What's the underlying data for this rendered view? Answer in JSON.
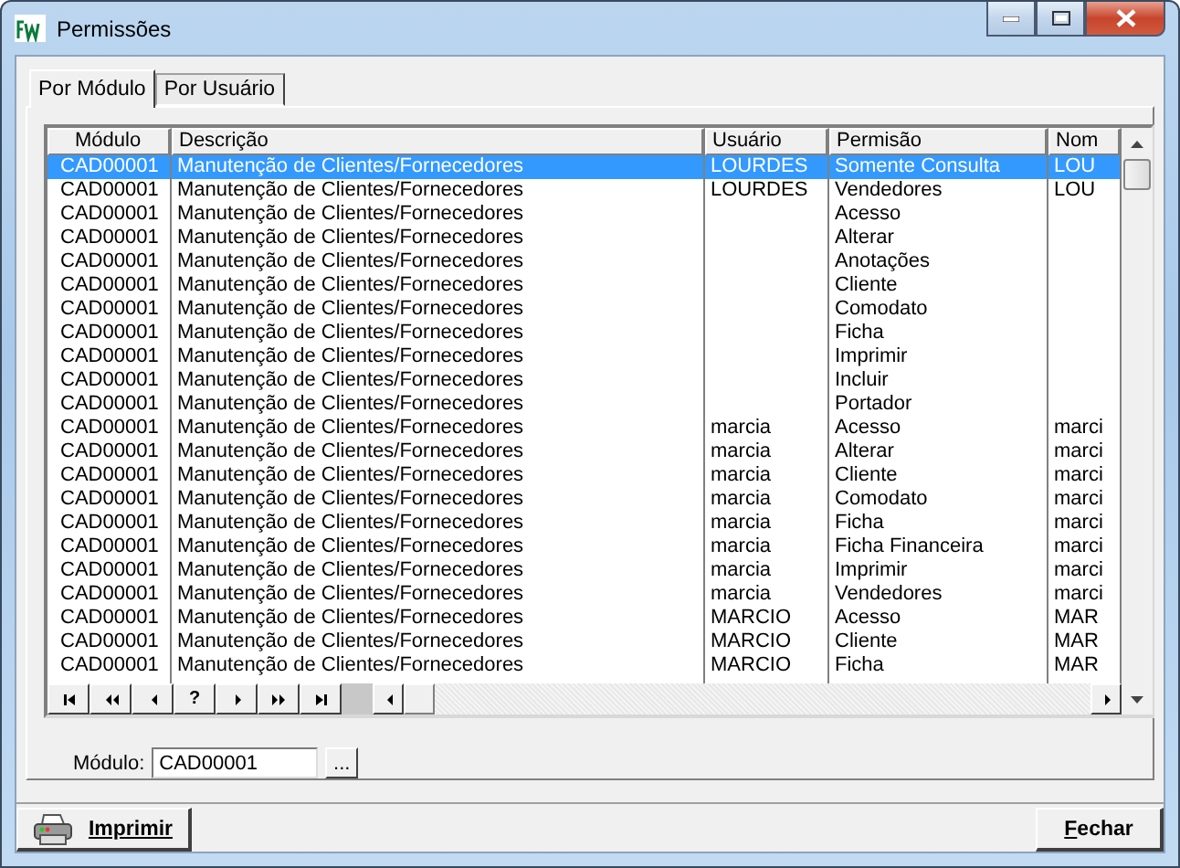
{
  "window": {
    "title": "Permissões"
  },
  "tabs": [
    {
      "label": "Por Módulo",
      "selected": true
    },
    {
      "label": "Por Usuário",
      "selected": false
    }
  ],
  "table": {
    "columns": [
      "Módulo",
      "Descrição",
      "Usuário",
      "Permisão",
      "Nom"
    ],
    "rows": [
      {
        "cells": [
          "CAD00001",
          "Manutenção de Clientes/Fornecedores",
          "LOURDES",
          "Somente Consulta",
          "LOU"
        ],
        "selected": true
      },
      {
        "cells": [
          "CAD00001",
          "Manutenção de Clientes/Fornecedores",
          "LOURDES",
          "Vendedores",
          "LOU"
        ],
        "selected": false
      },
      {
        "cells": [
          "CAD00001",
          "Manutenção de Clientes/Fornecedores",
          "",
          "Acesso",
          ""
        ],
        "selected": false
      },
      {
        "cells": [
          "CAD00001",
          "Manutenção de Clientes/Fornecedores",
          "",
          "Alterar",
          ""
        ],
        "selected": false
      },
      {
        "cells": [
          "CAD00001",
          "Manutenção de Clientes/Fornecedores",
          "",
          "Anotações",
          ""
        ],
        "selected": false
      },
      {
        "cells": [
          "CAD00001",
          "Manutenção de Clientes/Fornecedores",
          "",
          "Cliente",
          ""
        ],
        "selected": false
      },
      {
        "cells": [
          "CAD00001",
          "Manutenção de Clientes/Fornecedores",
          "",
          "Comodato",
          ""
        ],
        "selected": false
      },
      {
        "cells": [
          "CAD00001",
          "Manutenção de Clientes/Fornecedores",
          "",
          "Ficha",
          ""
        ],
        "selected": false
      },
      {
        "cells": [
          "CAD00001",
          "Manutenção de Clientes/Fornecedores",
          "",
          "Imprimir",
          ""
        ],
        "selected": false
      },
      {
        "cells": [
          "CAD00001",
          "Manutenção de Clientes/Fornecedores",
          "",
          "Incluir",
          ""
        ],
        "selected": false
      },
      {
        "cells": [
          "CAD00001",
          "Manutenção de Clientes/Fornecedores",
          "",
          "Portador",
          ""
        ],
        "selected": false
      },
      {
        "cells": [
          "CAD00001",
          "Manutenção de Clientes/Fornecedores",
          "marcia",
          "Acesso",
          "marci"
        ],
        "selected": false
      },
      {
        "cells": [
          "CAD00001",
          "Manutenção de Clientes/Fornecedores",
          "marcia",
          "Alterar",
          "marci"
        ],
        "selected": false
      },
      {
        "cells": [
          "CAD00001",
          "Manutenção de Clientes/Fornecedores",
          "marcia",
          "Cliente",
          "marci"
        ],
        "selected": false
      },
      {
        "cells": [
          "CAD00001",
          "Manutenção de Clientes/Fornecedores",
          "marcia",
          "Comodato",
          "marci"
        ],
        "selected": false
      },
      {
        "cells": [
          "CAD00001",
          "Manutenção de Clientes/Fornecedores",
          "marcia",
          "Ficha",
          "marci"
        ],
        "selected": false
      },
      {
        "cells": [
          "CAD00001",
          "Manutenção de Clientes/Fornecedores",
          "marcia",
          "Ficha Financeira",
          "marci"
        ],
        "selected": false
      },
      {
        "cells": [
          "CAD00001",
          "Manutenção de Clientes/Fornecedores",
          "marcia",
          "Imprimir",
          "marci"
        ],
        "selected": false
      },
      {
        "cells": [
          "CAD00001",
          "Manutenção de Clientes/Fornecedores",
          "marcia",
          "Vendedores",
          "marci"
        ],
        "selected": false
      },
      {
        "cells": [
          "CAD00001",
          "Manutenção de Clientes/Fornecedores",
          "MARCIO",
          "Acesso",
          "MAR"
        ],
        "selected": false
      },
      {
        "cells": [
          "CAD00001",
          "Manutenção de Clientes/Fornecedores",
          "MARCIO",
          "Cliente",
          "MAR"
        ],
        "selected": false
      },
      {
        "cells": [
          "CAD00001",
          "Manutenção de Clientes/Fornecedores",
          "MARCIO",
          "Ficha",
          "MAR"
        ],
        "selected": false
      }
    ]
  },
  "navigator": {
    "help_label": "?"
  },
  "module_field": {
    "label": "Módulo:",
    "value": "CAD00001",
    "browse_label": "..."
  },
  "buttons": {
    "print": "Imprimir",
    "close": "Fechar"
  }
}
